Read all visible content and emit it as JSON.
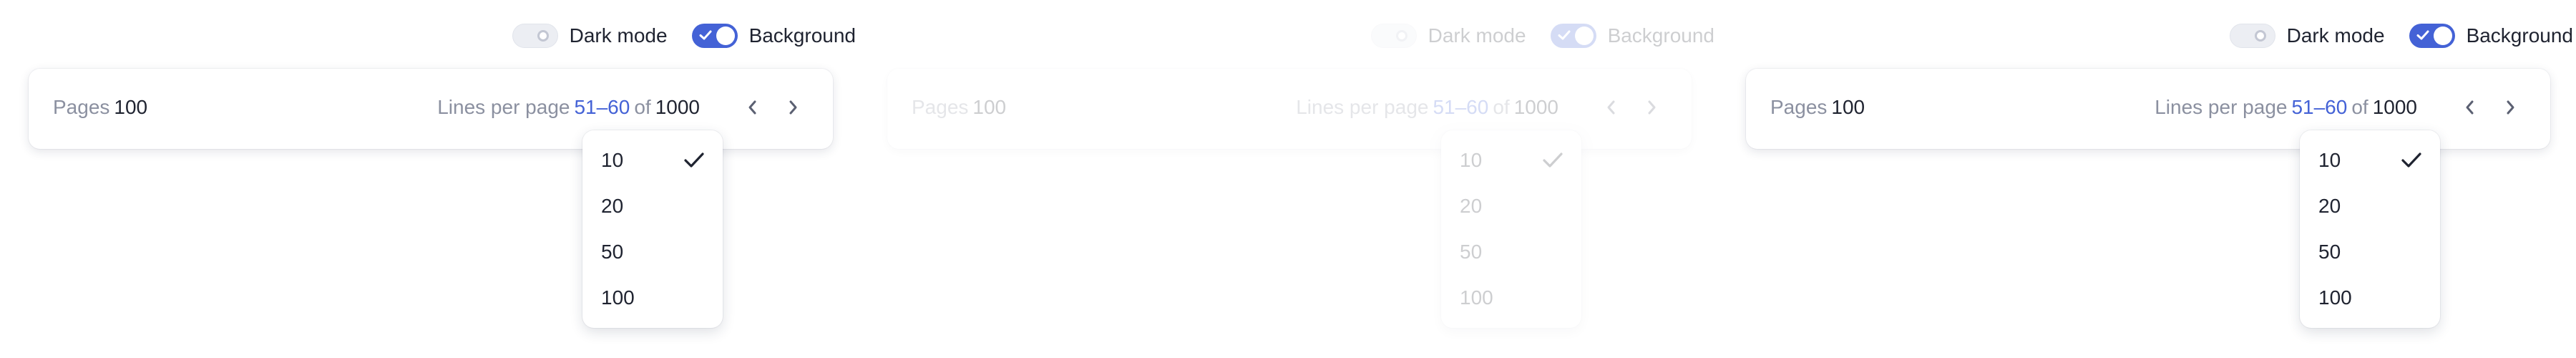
{
  "toggles": {
    "dark_mode_label": "Dark mode",
    "background_label": "Background",
    "dark_mode_on": false,
    "background_on": true
  },
  "pagination": {
    "pages_label": "Pages",
    "pages_value": "100",
    "lines_label": "Lines per page",
    "range": "51–60",
    "of_label": "of",
    "total": "1000"
  },
  "dropdown": {
    "options": [
      "10",
      "20",
      "50",
      "100"
    ],
    "selected": "10"
  },
  "icons": {
    "prev": "chevron-left-icon",
    "next": "chevron-right-icon",
    "check": "check-icon"
  },
  "colors": {
    "accent": "#4462d6",
    "muted_text": "#8b90a0",
    "text": "#1f2330"
  }
}
